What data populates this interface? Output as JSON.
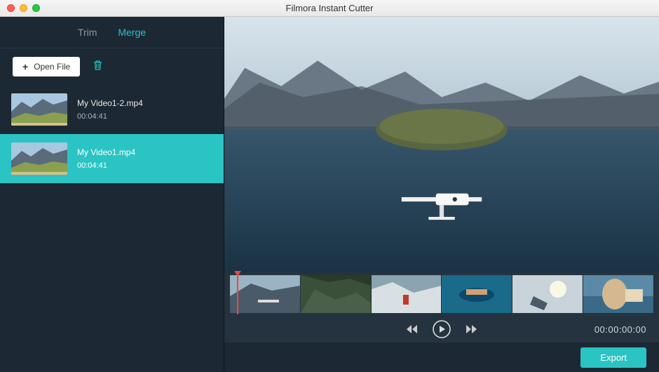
{
  "window": {
    "title": "Filmora Instant Cutter"
  },
  "tabs": {
    "trim": "Trim",
    "merge": "Merge",
    "active": "merge"
  },
  "toolbar": {
    "open_label": "Open File"
  },
  "clips": [
    {
      "name": "My Video1-2.mp4",
      "duration": "00:04:41"
    },
    {
      "name": "My Video1.mp4",
      "duration": "00:04:41"
    }
  ],
  "playback": {
    "timecode": "00:00:00:00"
  },
  "footer": {
    "export_label": "Export"
  }
}
